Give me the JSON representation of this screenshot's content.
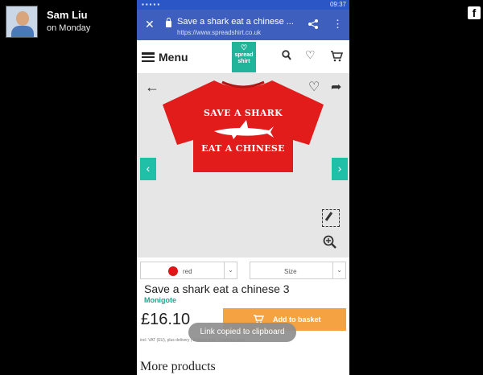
{
  "post": {
    "poster_name": "Sam Liu",
    "post_time": "on Monday",
    "facebook_glyph": "f"
  },
  "status_bar": {
    "time": "09:37"
  },
  "browser": {
    "close_glyph": "✕",
    "page_title": "Save a shark eat a chinese ...",
    "url": "https://www.spreadshirt.co.uk",
    "share_glyph": "<",
    "more_glyph": "⋮"
  },
  "site_nav": {
    "menu_label": "Menu",
    "logo_line1": "spread",
    "logo_line2": "shirt",
    "icons": [
      "search-icon",
      "heart-icon",
      "cart-icon"
    ]
  },
  "product_image": {
    "shirt_line1": "SAVE A SHARK",
    "shirt_line2": "EAT A CHINESE",
    "shirt_color": "#e21b1b"
  },
  "options": {
    "color_value": "red",
    "size_placeholder": "Size",
    "caret_glyph": "⌄"
  },
  "product": {
    "title": "Save a shark eat a chinese 3",
    "designer": "Monigote",
    "price": "£16.10",
    "add_to_basket": "Add to basket",
    "vat_note": "incl. VAT (EU), plus delivery | Delivery time: 5 working days"
  },
  "toast": "Link copied to clipboard",
  "more_products": "More products",
  "colors": {
    "browser_bar": "#3f5fbf",
    "brand": "#22b39b",
    "basket_button": "#f5a342",
    "designer_link": "#1ba98f"
  }
}
